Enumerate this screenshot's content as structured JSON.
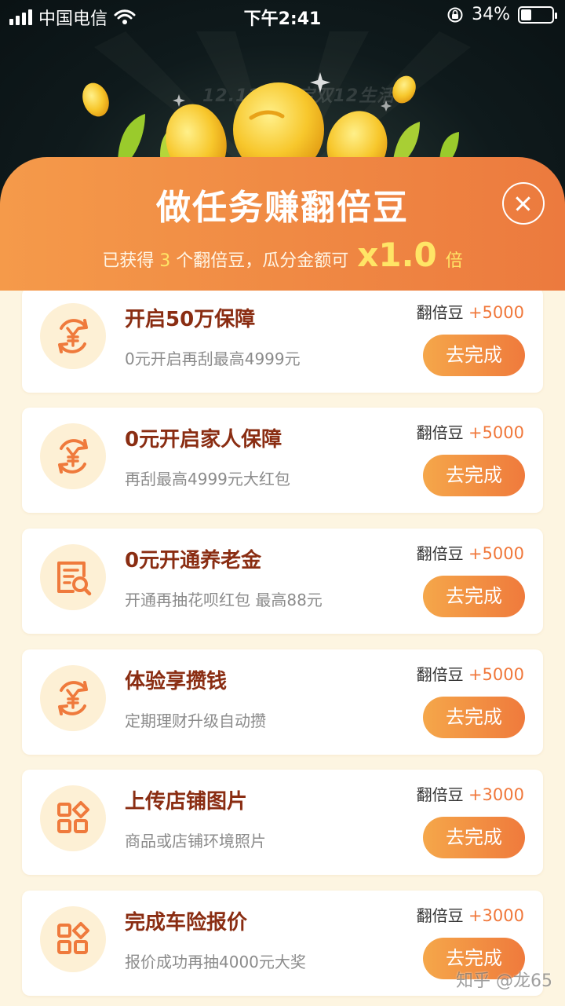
{
  "status_bar": {
    "carrier": "中国电信",
    "time": "下午2:41",
    "battery_text": "34%",
    "battery_level": 0.34
  },
  "banner": {
    "festival_text": "12.12支付宝双12生活节"
  },
  "header": {
    "title": "做任务赚翻倍豆",
    "earned_prefix": "已获得",
    "earned_count": "3",
    "earned_suffix": "个翻倍豆，瓜分金额可",
    "multiplier": "x1.0",
    "multiplier_unit": "倍"
  },
  "reward_label": "翻倍豆",
  "button_label": "去完成",
  "tasks": [
    {
      "title": "开启50万保障",
      "desc": "0元开启再刮最高4999元",
      "points": "+5000",
      "icon": "yuan-refresh-icon"
    },
    {
      "title": "0元开启家人保障",
      "desc": "再刮最高4999元大红包",
      "points": "+5000",
      "icon": "yuan-refresh-icon"
    },
    {
      "title": "0元开通养老金",
      "desc": "开通再抽花呗红包 最高88元",
      "points": "+5000",
      "icon": "document-search-icon"
    },
    {
      "title": "体验享攒钱",
      "desc": "定期理财升级自动攒",
      "points": "+5000",
      "icon": "yuan-refresh-icon"
    },
    {
      "title": "上传店铺图片",
      "desc": "商品或店铺环境照片",
      "points": "+3000",
      "icon": "app-grid-icon"
    },
    {
      "title": "完成车险报价",
      "desc": "报价成功再抽4000元大奖",
      "points": "+3000",
      "icon": "app-grid-icon"
    }
  ],
  "watermark": "知乎 @龙65",
  "colors": {
    "accent_orange": "#f08a44",
    "title_brown": "#8a2d12",
    "highlight_yellow": "#ffe566",
    "page_cream": "#fdf5e1"
  }
}
